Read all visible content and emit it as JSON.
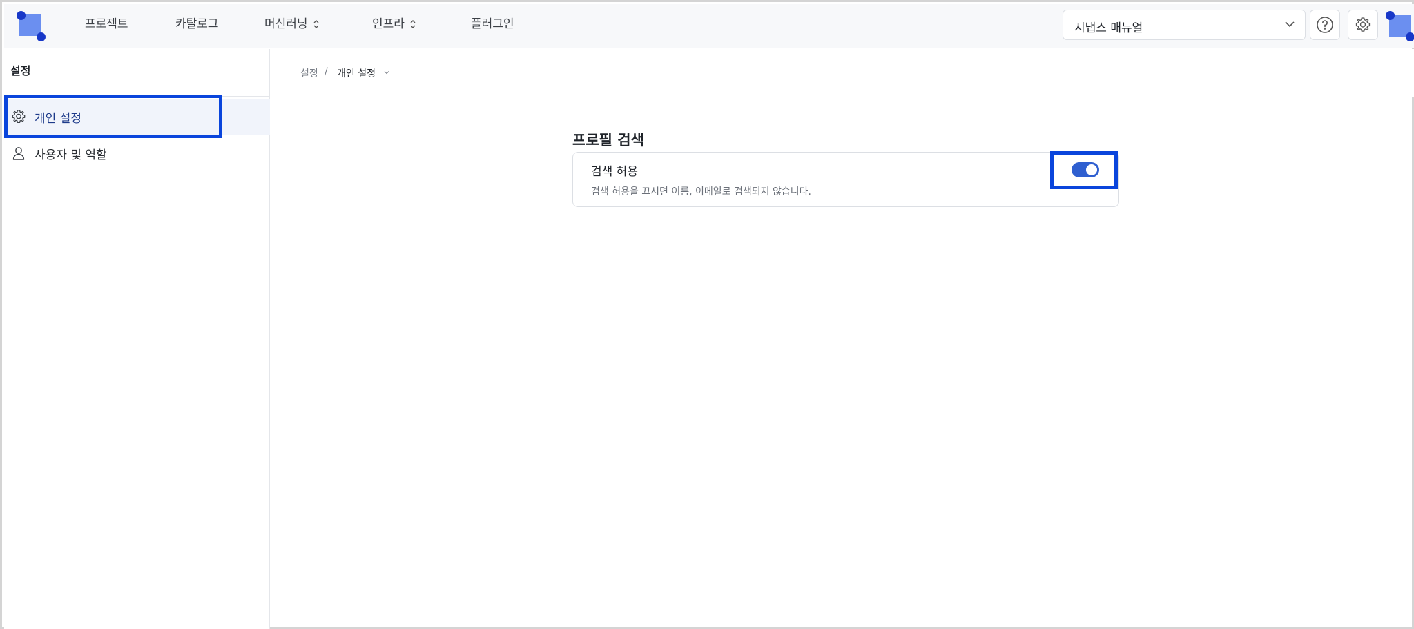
{
  "colors": {
    "brand": "#6b8ff0",
    "brand_dark": "#1838c8",
    "accent": "#2f5fd0",
    "highlight": "#0a45dc",
    "sidebar_active_bg": "#f1f4fb"
  },
  "topbar": {
    "nav": [
      {
        "label": "프로젝트",
        "has_chevron": false
      },
      {
        "label": "카탈로그",
        "has_chevron": false
      },
      {
        "label": "머신러닝",
        "has_chevron": true
      },
      {
        "label": "인프라",
        "has_chevron": true
      },
      {
        "label": "플러그인",
        "has_chevron": false
      }
    ],
    "chevron_glyph": "⌃⌄",
    "manual_label": "시냅스 매뉴얼",
    "icons": [
      "logo",
      "chevron-down-icon",
      "help-icon",
      "gear-icon",
      "avatar"
    ]
  },
  "sidebar": {
    "title": "설정",
    "items": [
      {
        "label": "개인 설정",
        "icon": "gear-icon",
        "active": true
      },
      {
        "label": "사용자 및 역할",
        "icon": "user-icon",
        "active": false
      }
    ]
  },
  "breadcrumb": {
    "root": "설정",
    "separator": "/",
    "current": "개인 설정",
    "current_dropdown": "⌄"
  },
  "profile_search": {
    "section_title": "프로필 검색",
    "setting_title": "검색 허용",
    "setting_description": "검색 허용을 끄시면 이름, 이메일로 검색되지 않습니다.",
    "enabled": true
  }
}
